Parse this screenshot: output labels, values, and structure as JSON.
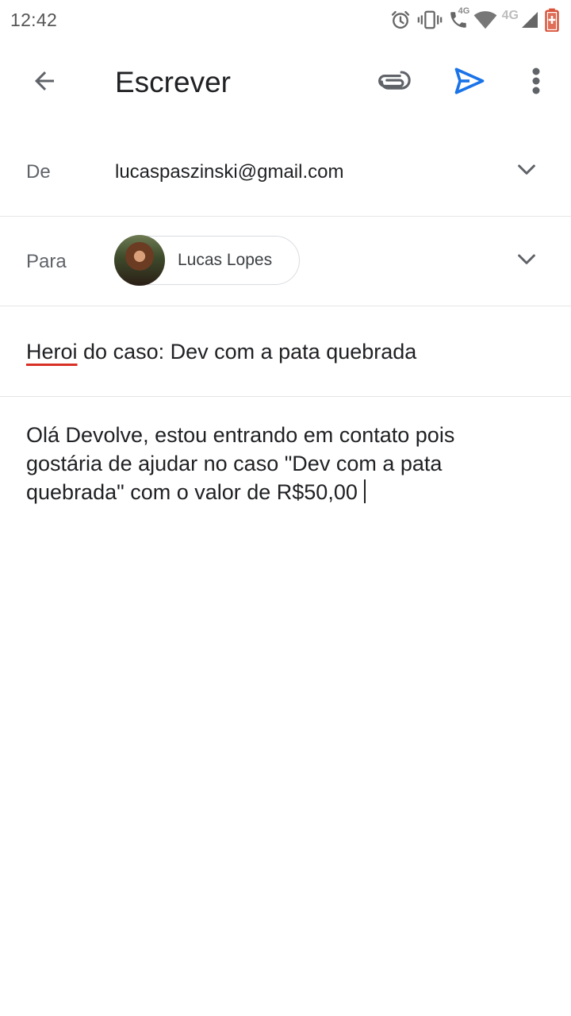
{
  "status_bar": {
    "time": "12:42",
    "network_4g_small": "4G",
    "network_4g": "4G",
    "icons": [
      "alarm-icon",
      "vibrate-icon",
      "wifi-call-icon",
      "wifi-icon",
      "signal-icon",
      "battery-icon"
    ],
    "battery_color": "#d9533b"
  },
  "app_bar": {
    "title": "Escrever",
    "icons": [
      "back-arrow-icon",
      "attach-icon",
      "send-icon",
      "more-vert-icon"
    ],
    "send_color": "#1a73e8"
  },
  "from": {
    "label": "De",
    "value": "lucaspaszinski@gmail.com"
  },
  "to": {
    "label": "Para",
    "recipient_name": "Lucas Lopes"
  },
  "subject": {
    "misspelled_word": "Heroi",
    "rest": " do caso: Dev com a pata quebrada"
  },
  "body": {
    "text": "Olá Devolve, estou entrando em contato pois gostária de ajudar no caso \"Dev com a pata quebrada\" com o valor de R$50,00"
  }
}
